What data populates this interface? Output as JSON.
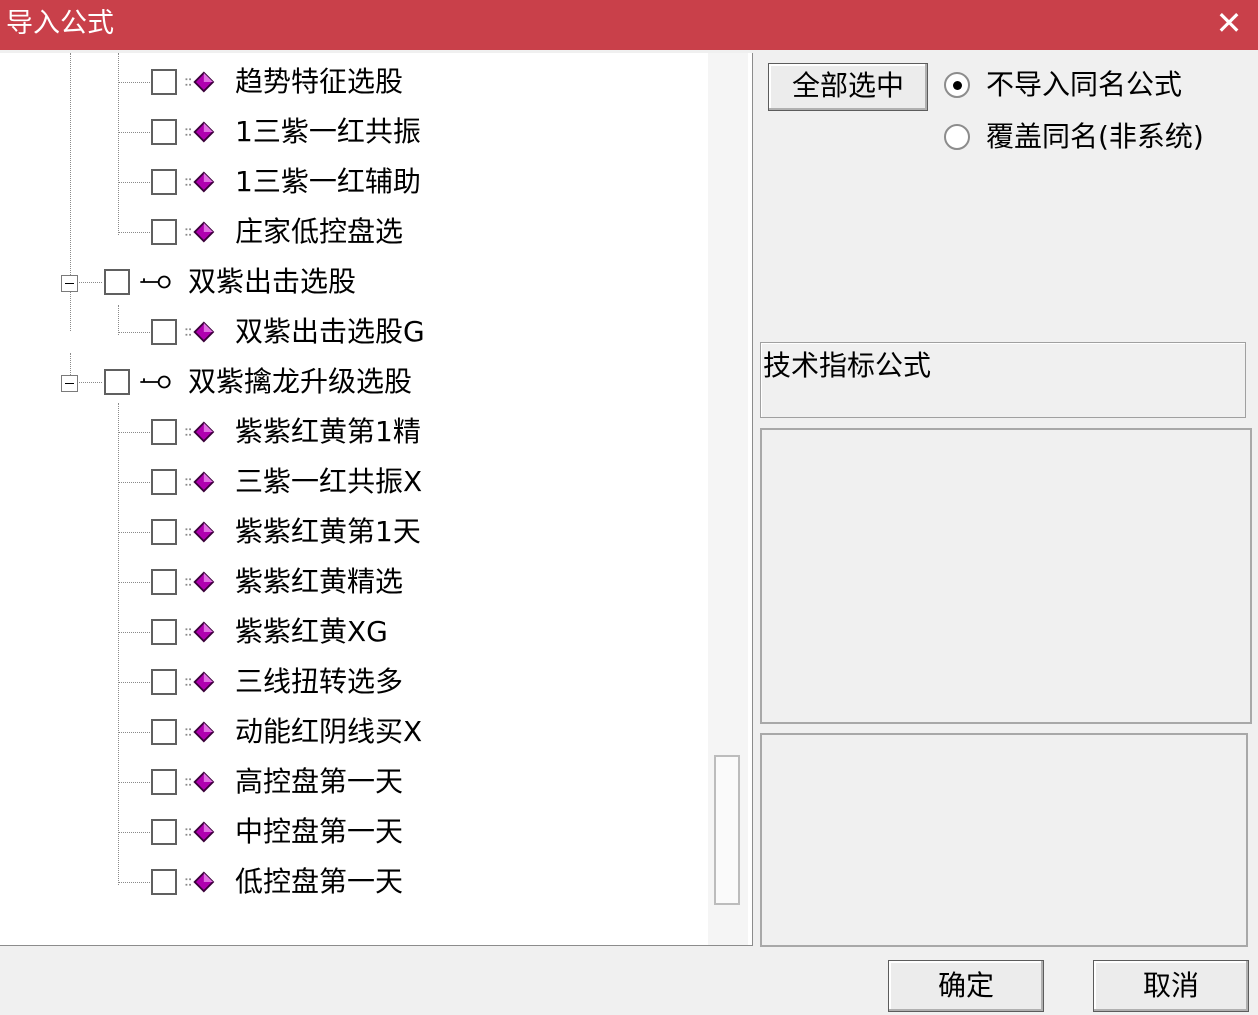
{
  "window": {
    "title": "导入公式",
    "close_glyph": "✕"
  },
  "tree": {
    "items": [
      {
        "label": "趋势特征选股",
        "level": 2,
        "type": "formula"
      },
      {
        "label": "1三紫一红共振",
        "level": 2,
        "type": "formula"
      },
      {
        "label": "1三紫一红辅助",
        "level": 2,
        "type": "formula"
      },
      {
        "label": "庄家低控盘选",
        "level": 2,
        "type": "formula"
      },
      {
        "label": "双紫出击选股",
        "level": 1,
        "type": "group",
        "expanded": true
      },
      {
        "label": "双紫出击选股G",
        "level": 2,
        "type": "formula"
      },
      {
        "label": "双紫擒龙升级选股",
        "level": 1,
        "type": "group",
        "expanded": true
      },
      {
        "label": "紫紫红黄第1精",
        "level": 2,
        "type": "formula"
      },
      {
        "label": "三紫一红共振X",
        "level": 2,
        "type": "formula"
      },
      {
        "label": "紫紫红黄第1天",
        "level": 2,
        "type": "formula"
      },
      {
        "label": "紫紫红黄精选",
        "level": 2,
        "type": "formula"
      },
      {
        "label": "紫紫红黄XG",
        "level": 2,
        "type": "formula"
      },
      {
        "label": "三线扭转选多",
        "level": 2,
        "type": "formula"
      },
      {
        "label": "动能红阴线买X",
        "level": 2,
        "type": "formula"
      },
      {
        "label": "高控盘第一天",
        "level": 2,
        "type": "formula"
      },
      {
        "label": "中控盘第一天",
        "level": 2,
        "type": "formula"
      },
      {
        "label": "低控盘第一天",
        "level": 2,
        "type": "formula"
      }
    ]
  },
  "options": {
    "select_all_label": "全部选中",
    "radio_no_import_label": "不导入同名公式",
    "radio_overwrite_label": "覆盖同名(非系统)",
    "selected": "no_import"
  },
  "info": {
    "formula_type": "技术指标公式"
  },
  "footer": {
    "ok_label": "确定",
    "cancel_label": "取消"
  },
  "colors": {
    "titlebar": "#c9404a",
    "formula_icon": "#b000b0"
  }
}
